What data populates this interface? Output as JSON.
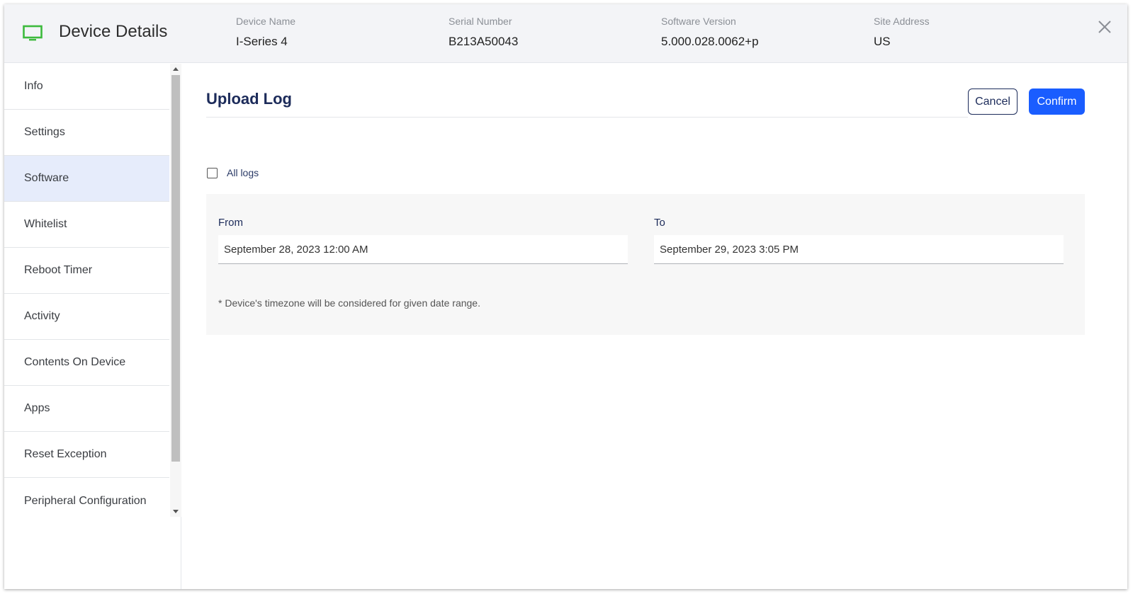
{
  "header": {
    "title": "Device Details",
    "icon": "monitor-icon",
    "icon_color": "#3dba3d",
    "meta": [
      {
        "label": "Device Name",
        "value": "I-Series 4"
      },
      {
        "label": "Serial Number",
        "value": "B213A50043"
      },
      {
        "label": "Software Version",
        "value": "5.000.028.0062+p"
      },
      {
        "label": "Site Address",
        "value": "US"
      }
    ]
  },
  "sidebar": {
    "items": [
      {
        "label": "Info"
      },
      {
        "label": "Settings"
      },
      {
        "label": "Software",
        "active": true
      },
      {
        "label": "Whitelist"
      },
      {
        "label": "Reboot Timer"
      },
      {
        "label": "Activity"
      },
      {
        "label": "Contents On Device"
      },
      {
        "label": "Apps"
      },
      {
        "label": "Reset Exception"
      },
      {
        "label": "Peripheral Configuration"
      }
    ]
  },
  "main": {
    "title": "Upload Log",
    "cancel_label": "Cancel",
    "confirm_label": "Confirm",
    "all_logs_label": "All logs",
    "all_logs_checked": false,
    "from_label": "From",
    "from_value": "September 28, 2023 12:00 AM",
    "to_label": "To",
    "to_value": "September 29, 2023 3:05 PM",
    "note": "* Device's timezone will be considered for given date range."
  },
  "colors": {
    "accent": "#1a5dff",
    "title_navy": "#1c2b5a",
    "active_nav_bg": "#e6ecfb"
  }
}
